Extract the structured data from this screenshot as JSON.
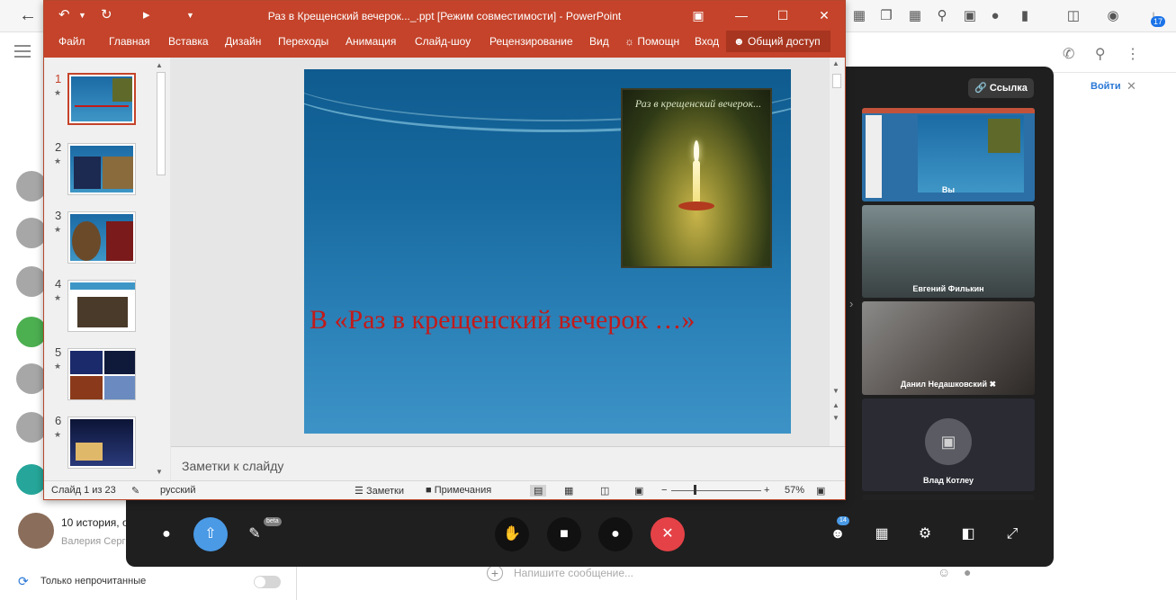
{
  "powerpoint": {
    "title": "Раз в Крещенский вечерок..._.ppt [Режим совместимости] - PowerPoint",
    "ribbon_tabs": [
      "Файл",
      "Главная",
      "Вставка",
      "Дизайн",
      "Переходы",
      "Анимация",
      "Слайд-шоу",
      "Рецензирование",
      "Вид"
    ],
    "help_label": "Помощн",
    "signin_label": "Вход",
    "share_label": "Общий доступ",
    "slide_numbers": [
      "1",
      "2",
      "3",
      "4",
      "5",
      "6"
    ],
    "star": "★",
    "slide": {
      "picture_title": "Раз в крещенский вечерок...",
      "caption": "В «Раз в крещенский вечерок …»"
    },
    "notes_placeholder": "Заметки к слайду",
    "status": {
      "slide_counter": "Слайд 1 из 23",
      "language": "русский",
      "notes_btn": "Заметки",
      "comments_btn": "Примечания",
      "zoom": "57%"
    }
  },
  "call": {
    "link_button": "Ссылка",
    "participants": [
      {
        "name": "Вы"
      },
      {
        "name": "Евгений Филькин"
      },
      {
        "name": "Данил Недашковский"
      },
      {
        "name": "Влад Котлеу"
      }
    ],
    "beta_badge": "beta",
    "participants_count": "14"
  },
  "messenger": {
    "join_button": "Войти",
    "chat_preview_title": "10 история, о",
    "chat_preview_sub": "Валерия Серг",
    "unread_only_label": "Только непрочитанные",
    "message_placeholder": "Напишите сообщение..."
  },
  "browser": {
    "notifications_badge": "17"
  },
  "colors": {
    "ppt_accent": "#c4432a",
    "hangup": "#e44247",
    "share_active": "#4a9ae6",
    "slide_text": "#c21a1a"
  }
}
